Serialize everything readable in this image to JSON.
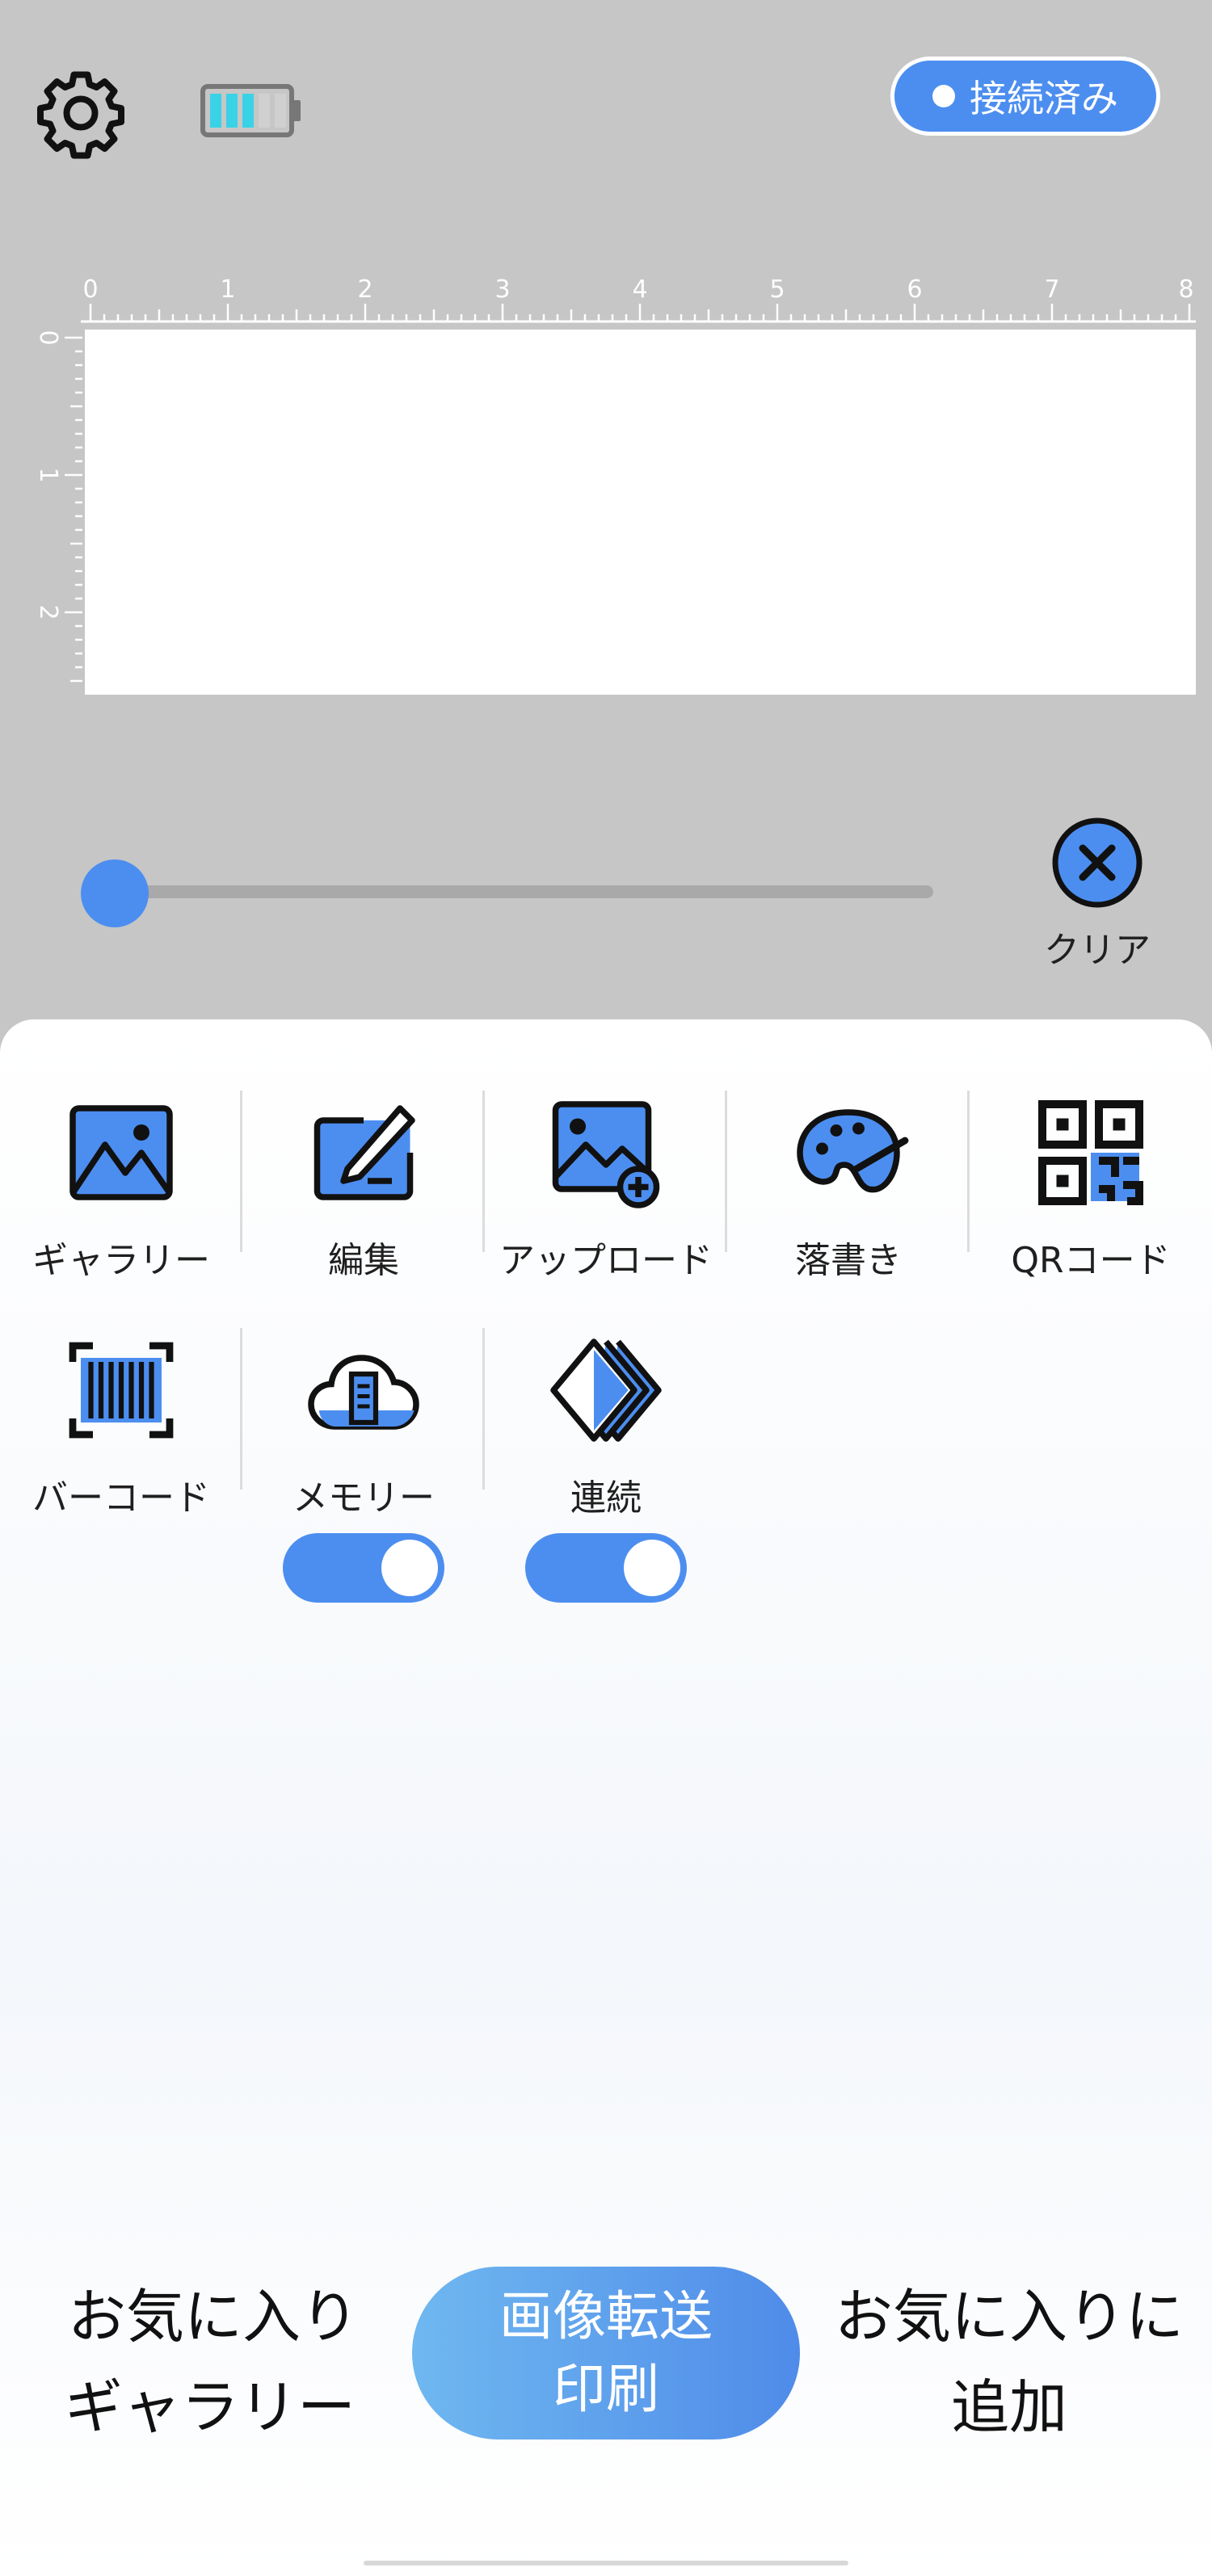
{
  "header": {
    "status_label": "接続済み",
    "battery_level": 0.6
  },
  "ruler": {
    "horizontal_ticks": [
      "0",
      "1",
      "2",
      "3",
      "4",
      "5",
      "6",
      "7",
      "8"
    ],
    "vertical_ticks": [
      "0",
      "1",
      "2"
    ]
  },
  "slider": {
    "value": 0
  },
  "clear": {
    "label": "クリア"
  },
  "tools": {
    "gallery": "ギャラリー",
    "edit": "編集",
    "upload": "アップロード",
    "doodle": "落書き",
    "qrcode": "QRコード",
    "barcode": "バーコード",
    "memory": "メモリー",
    "continuous": "連続"
  },
  "toggles": {
    "memory_on": true,
    "continuous_on": true
  },
  "bottom": {
    "favorites_gallery_line1": "お気に入り",
    "favorites_gallery_line2": "ギャラリー",
    "print_line1": "画像転送",
    "print_line2": "印刷",
    "add_favorite_line1": "お気に入りに",
    "add_favorite_line2": "追加"
  },
  "colors": {
    "accent": "#4c8ef0",
    "background": "#c6c6c6",
    "panel": "#ffffff"
  },
  "icons": {
    "settings": "gear-icon",
    "battery": "battery-icon",
    "clear": "close-circle-icon"
  }
}
